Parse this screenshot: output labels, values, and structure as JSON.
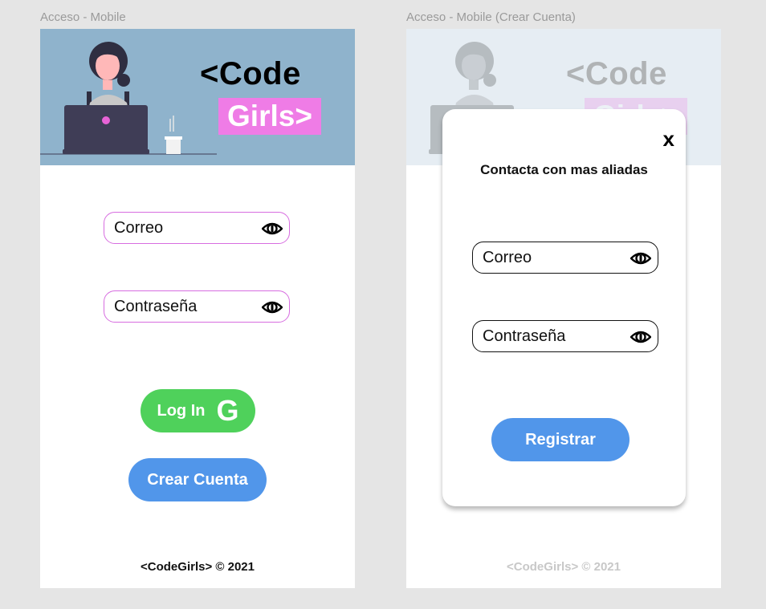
{
  "frames": {
    "left": {
      "label": "Acceso - Mobile",
      "brand": {
        "code": "<Code",
        "girls": "Girls>"
      },
      "fields": {
        "email_placeholder": "Correo",
        "password_placeholder": "Contraseña"
      },
      "buttons": {
        "login_label": "Log In",
        "google_letter": "G",
        "create_account_label": "Crear Cuenta"
      },
      "footer": "<CodeGirls> © 2021"
    },
    "right": {
      "label": "Acceso - Mobile (Crear Cuenta)",
      "brand": {
        "code": "<Code",
        "girls": "Girls>"
      },
      "modal": {
        "close_label": "x",
        "title": "Contacta con mas aliadas",
        "email_placeholder": "Correo",
        "password_placeholder": "Contraseña",
        "register_label": "Registrar"
      },
      "footer": "<CodeGirls> © 2021"
    }
  },
  "colors": {
    "hero_bg": "#8fb3cc",
    "brand_pink": "#ef7ce6",
    "login_green": "#4fd15b",
    "action_blue": "#5196ea",
    "field_border_pink": "#d76de0"
  },
  "icons": {
    "field_toggle": "eye-icon",
    "hero_art": "woman-at-laptop-illustration"
  }
}
